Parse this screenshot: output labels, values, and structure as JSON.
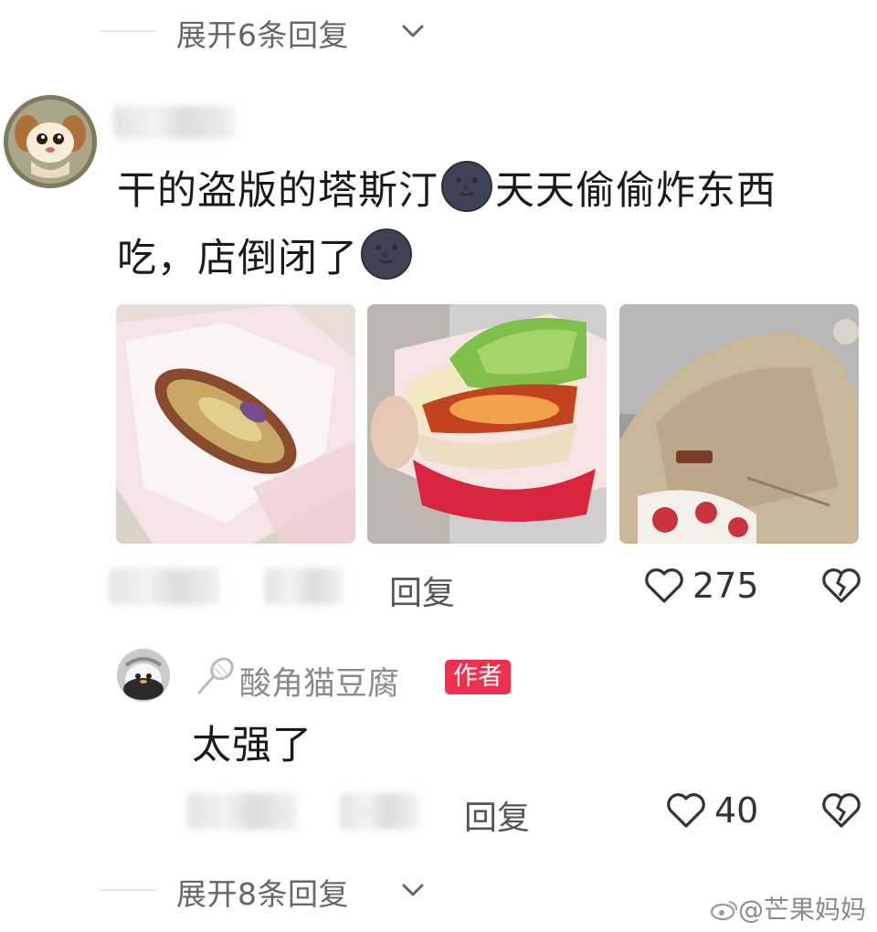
{
  "thread": {
    "expand_top": "展开6条回复",
    "expand_bottom": "展开8条回复"
  },
  "comment": {
    "line1": "干的盗版的塔斯汀",
    "line1_after": "天天偷偷炸东西",
    "line2": "吃，店倒闭了",
    "emoji": "new-moon-face-icon",
    "reply_label": "回复",
    "like_count": "275",
    "photos": [
      "burger-photo-1",
      "burger-photo-2",
      "jacket-photo"
    ]
  },
  "reply": {
    "username": "酸角猫豆腐",
    "author_tag": "作者",
    "text": "太强了",
    "reply_label": "回复",
    "like_count": "40"
  },
  "watermark": "@芒果妈妈",
  "colors": {
    "author_tag": "#f0304f",
    "secondary_text": "#666666",
    "primary_text": "#1a1a1a"
  }
}
